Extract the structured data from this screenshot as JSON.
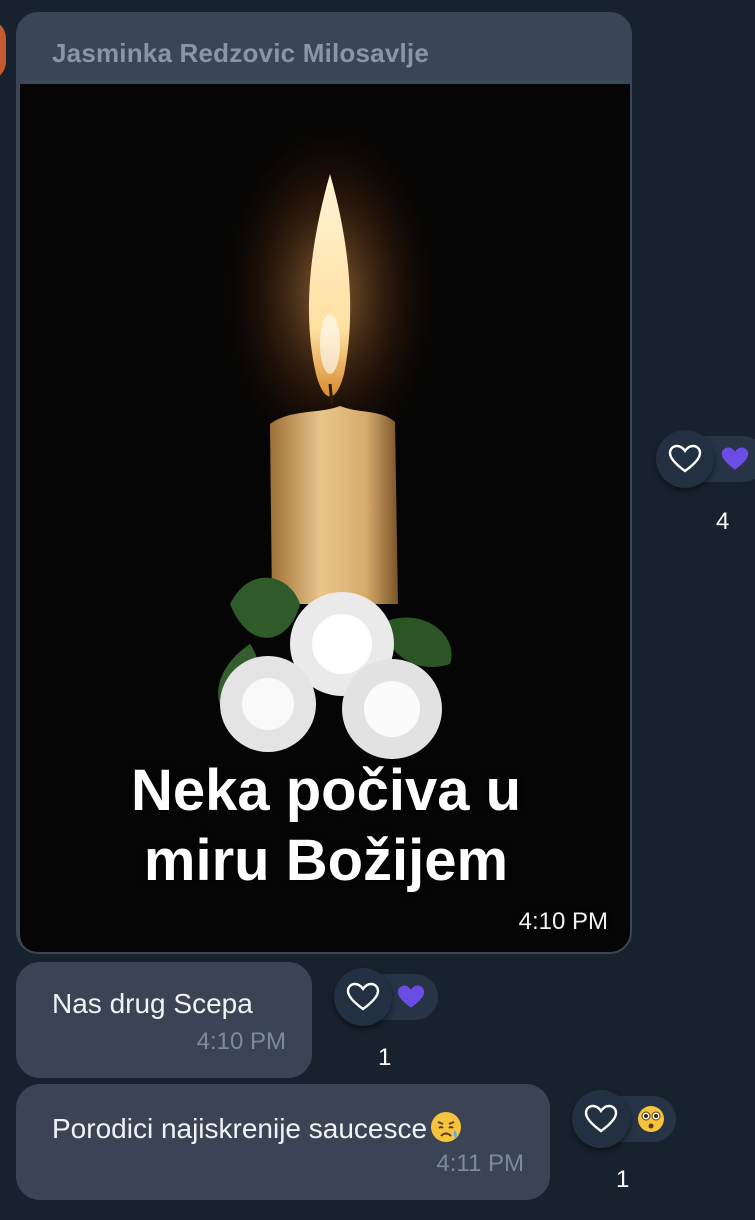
{
  "image_message": {
    "sender": "Jasminka Redzovic Milosavlje",
    "caption_line1": "Neka počiva u",
    "caption_line2": "miru Božijem",
    "time": "4:10 PM",
    "reaction_count": "4"
  },
  "messages": [
    {
      "text": "Nas drug Scepa",
      "time": "4:10 PM",
      "reaction_count": "1",
      "reaction_icon": "purple-heart-icon"
    },
    {
      "text": "Porodici najiskrenije saucesce",
      "time": "4:11 PM",
      "reaction_count": "1",
      "reaction_icon": "flushed-face-icon"
    }
  ],
  "colors": {
    "background": "#18222e",
    "bubble": "#3a4454",
    "sender_name": "#8a96a6",
    "reaction_heart": "#6b4de6"
  }
}
